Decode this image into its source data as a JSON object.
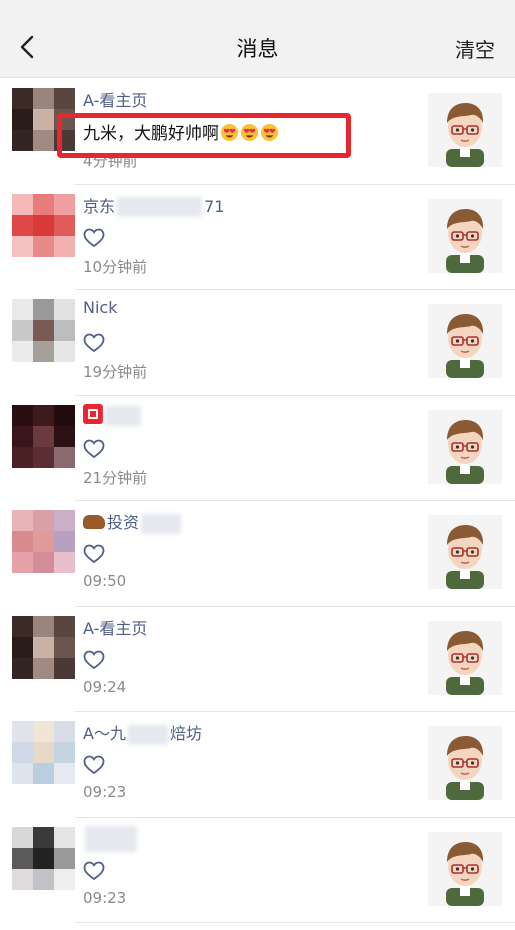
{
  "nav": {
    "title": "消息",
    "clear_label": "清空"
  },
  "colors": {
    "name": "#4e5f88",
    "time": "#8a8a8a",
    "highlight": "#e8262f",
    "navbar_bg": "#f2f2f2"
  },
  "rows": [
    {
      "name": "A-看主页",
      "content": "九米，大鹏好帅啊",
      "emoji_count": 3,
      "time": "4分钟前",
      "liked": false
    },
    {
      "name_start": "京东",
      "name_end": "71",
      "time": "10分钟前",
      "liked": true
    },
    {
      "name": "Nick",
      "time": "19分钟前",
      "liked": true
    },
    {
      "name": "",
      "time": "21分钟前",
      "liked": true
    },
    {
      "name": "投资",
      "time": "09:50",
      "liked": true
    },
    {
      "name": "A-看主页",
      "time": "09:24",
      "liked": true
    },
    {
      "name_start": "A～九",
      "name_end": "焙坊",
      "time": "09:23",
      "liked": true
    },
    {
      "name": "",
      "time": "09:23",
      "liked": true
    }
  ]
}
